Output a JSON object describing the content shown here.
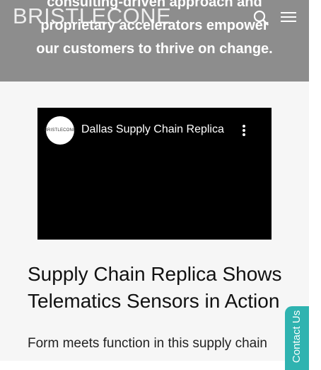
{
  "hero": {
    "lines": [
      "consulting-driven approach and",
      "proprietary accelerators empower",
      "our customers to thrive on change."
    ]
  },
  "header": {
    "logo_text": "BRISTLECONE",
    "search_icon": "search-icon",
    "menu_icon": "hamburger-menu-icon"
  },
  "video": {
    "channel_logo_text": "BRISTLECONE",
    "title": "Dallas Supply Chain Replica",
    "more_icon": "more-vertical-icon"
  },
  "article": {
    "heading": "Supply Chain Replica Shows Telematics Sensors in Action",
    "body": "Form meets function in this supply chain"
  },
  "contact_tab": {
    "label": "Contact Us",
    "color": "#2fb3b0"
  },
  "colors": {
    "hero_bg": "#8d8d8d",
    "page_bg": "#f6f6f6",
    "video_bg": "#000000"
  }
}
